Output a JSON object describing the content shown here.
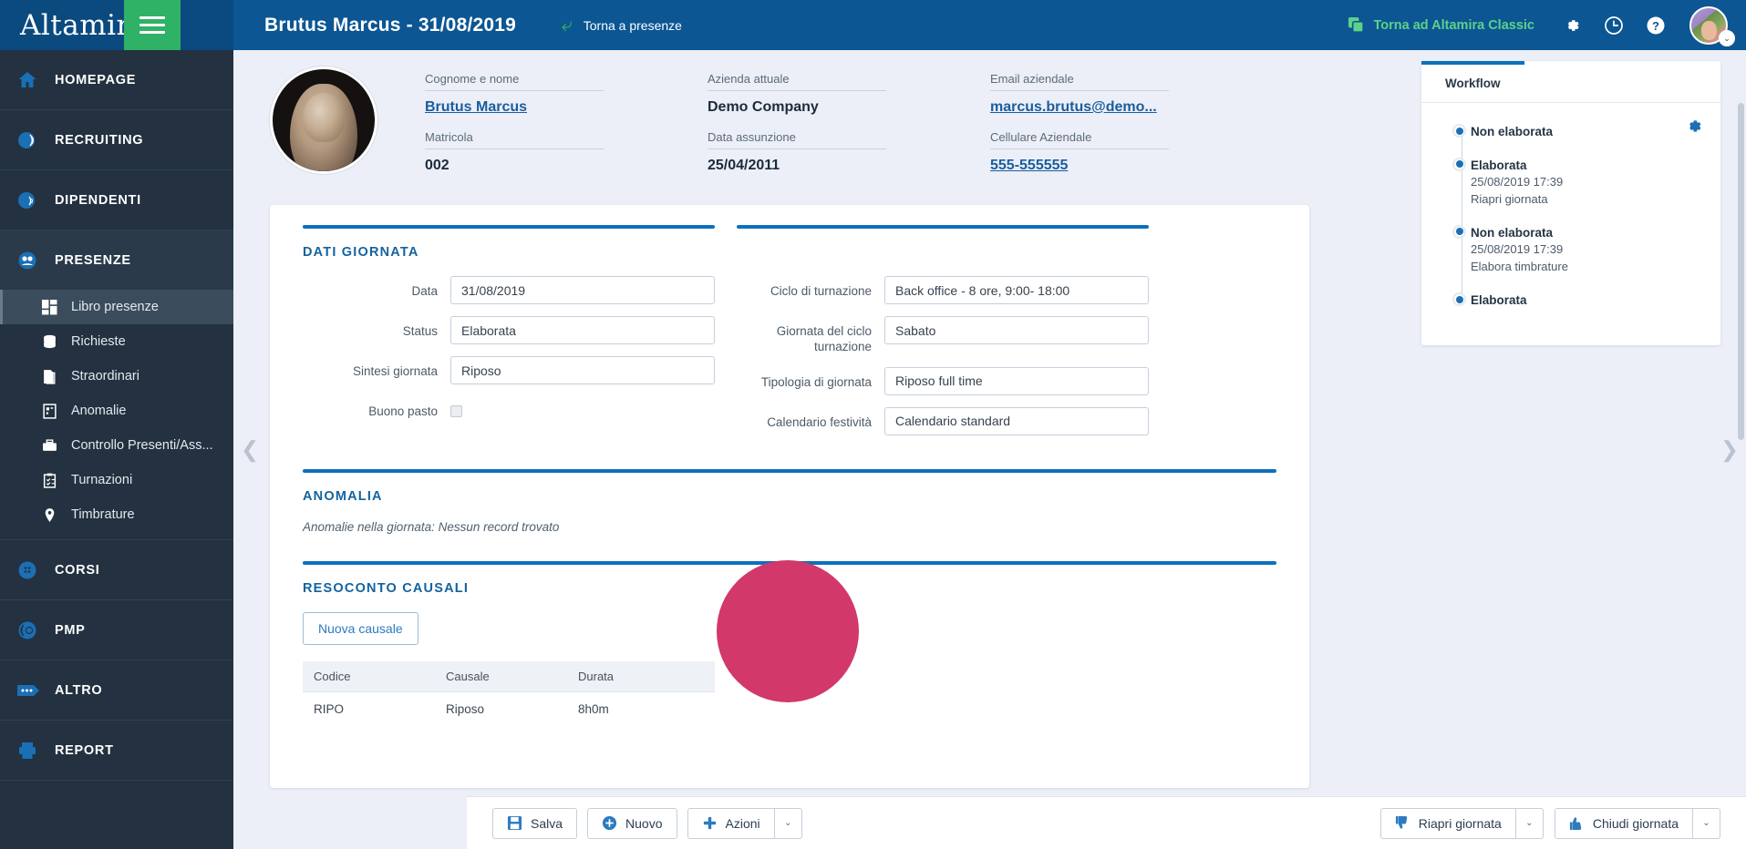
{
  "brand": {
    "name": "Altamira",
    "burger_icon": "hamburger-menu-icon"
  },
  "sidebar": {
    "items": [
      {
        "label": "HOMEPAGE",
        "icon": "home-icon"
      },
      {
        "label": "RECRUITING",
        "icon": "recruiting-icon"
      },
      {
        "label": "DIPENDENTI",
        "icon": "employees-icon"
      },
      {
        "label": "PRESENZE",
        "icon": "attendance-icon",
        "active": true,
        "subitems": [
          {
            "label": "Libro presenze",
            "icon": "grid-icon",
            "active": true
          },
          {
            "label": "Richieste",
            "icon": "database-icon"
          },
          {
            "label": "Straordinari",
            "icon": "documents-icon"
          },
          {
            "label": "Anomalie",
            "icon": "report-grid-icon"
          },
          {
            "label": "Controllo Presenti/Ass...",
            "icon": "briefcase-icon"
          },
          {
            "label": "Turnazioni",
            "icon": "clipboard-check-icon"
          },
          {
            "label": "Timbrature",
            "icon": "map-pin-icon"
          }
        ]
      },
      {
        "label": "CORSI",
        "icon": "courses-icon"
      },
      {
        "label": "PMP",
        "icon": "pmp-icon"
      },
      {
        "label": "ALTRO",
        "icon": "more-dots-icon"
      },
      {
        "label": "REPORT",
        "icon": "report-printer-icon"
      }
    ]
  },
  "topbar": {
    "title": "Brutus Marcus - 31/08/2019",
    "back_label": "Torna a presenze",
    "back_icon": "back-arrow-icon",
    "classic_label": "Torna ad Altamira Classic",
    "classic_icon": "copy-windows-icon",
    "icons": [
      {
        "name": "gear-icon",
        "glyph": "gear"
      },
      {
        "name": "clock-icon",
        "glyph": "clock"
      },
      {
        "name": "help-icon",
        "glyph": "question"
      }
    ],
    "avatar_name": "user-avatar",
    "avatar_caret": "⌄"
  },
  "profile": {
    "photo_alt": "employee-photo",
    "fields": [
      {
        "label": "Cognome e nome",
        "value": "Brutus Marcus",
        "link": true
      },
      {
        "label": "Matricola",
        "value": "002",
        "link": false
      },
      {
        "label": "Azienda attuale",
        "value": "Demo Company",
        "link": false
      },
      {
        "label": "Data assunzione",
        "value": "25/04/2011",
        "link": false
      },
      {
        "label": "Email aziendale",
        "value": "marcus.brutus@demo...",
        "link": true
      },
      {
        "label": "Cellulare Aziendale",
        "value": "555-555555",
        "link": true
      }
    ]
  },
  "dati_giornata": {
    "title": "DATI GIORNATA",
    "left_fields": [
      {
        "label": "Data",
        "value": "31/08/2019",
        "type": "text"
      },
      {
        "label": "Status",
        "value": "Elaborata",
        "type": "text"
      },
      {
        "label": "Sintesi giornata",
        "value": "Riposo",
        "type": "text"
      },
      {
        "label": "Buono pasto",
        "value": "",
        "type": "checkbox",
        "checked": false
      }
    ],
    "right_fields": [
      {
        "label": "Ciclo di turnazione",
        "value": "Back office - 8 ore, 9:00- 18:00",
        "type": "text"
      },
      {
        "label": "Giornata del ciclo turnazione",
        "value": "Sabato",
        "type": "text"
      },
      {
        "label": "Tipologia di giornata",
        "value": "Riposo full time",
        "type": "text"
      },
      {
        "label": "Calendario festività",
        "value": "Calendario standard",
        "type": "text"
      }
    ]
  },
  "anomalia": {
    "title": "ANOMALIA",
    "message": "Anomalie nella giornata: Nessun record trovato"
  },
  "resoconto": {
    "title": "RESOCONTO CAUSALI",
    "new_button": "Nuova causale",
    "columns": [
      "Codice",
      "Causale",
      "Durata"
    ],
    "rows": [
      {
        "codice": "RIPO",
        "causale": "Riposo",
        "durata": "8h0m"
      }
    ]
  },
  "workflow": {
    "tab_label": "Workflow",
    "gear_icon": "gear-icon",
    "steps": [
      {
        "state": "Non elaborata",
        "timestamp": "",
        "action": ""
      },
      {
        "state": "Elaborata",
        "timestamp": "25/08/2019 17:39",
        "action": "Riapri giornata"
      },
      {
        "state": "Non elaborata",
        "timestamp": "25/08/2019 17:39",
        "action": "Elabora timbrature"
      },
      {
        "state": "Elaborata",
        "timestamp": "",
        "action": ""
      }
    ]
  },
  "footer": {
    "left_buttons": [
      {
        "label": "Salva",
        "icon": "save-disk-icon"
      },
      {
        "label": "Nuovo",
        "icon": "plus-circle-icon"
      },
      {
        "label": "Azioni",
        "icon": "plus-cross-icon",
        "caret": true
      }
    ],
    "right_buttons": [
      {
        "label": "Riapri giornata",
        "icon": "thumbs-down-icon",
        "caret": true
      },
      {
        "label": "Chiudi giornata",
        "icon": "thumbs-up-icon",
        "caret": true
      }
    ],
    "caret_glyph": "⌄"
  },
  "nav_arrows": {
    "left": "❮",
    "right": "❯"
  },
  "colors": {
    "brand_blue": "#0b4a7f",
    "topbar_blue": "#0b5693",
    "green": "#2fb166",
    "sidebar": "#233140",
    "accent": "#0e70bb",
    "link": "#1a5d9e"
  }
}
